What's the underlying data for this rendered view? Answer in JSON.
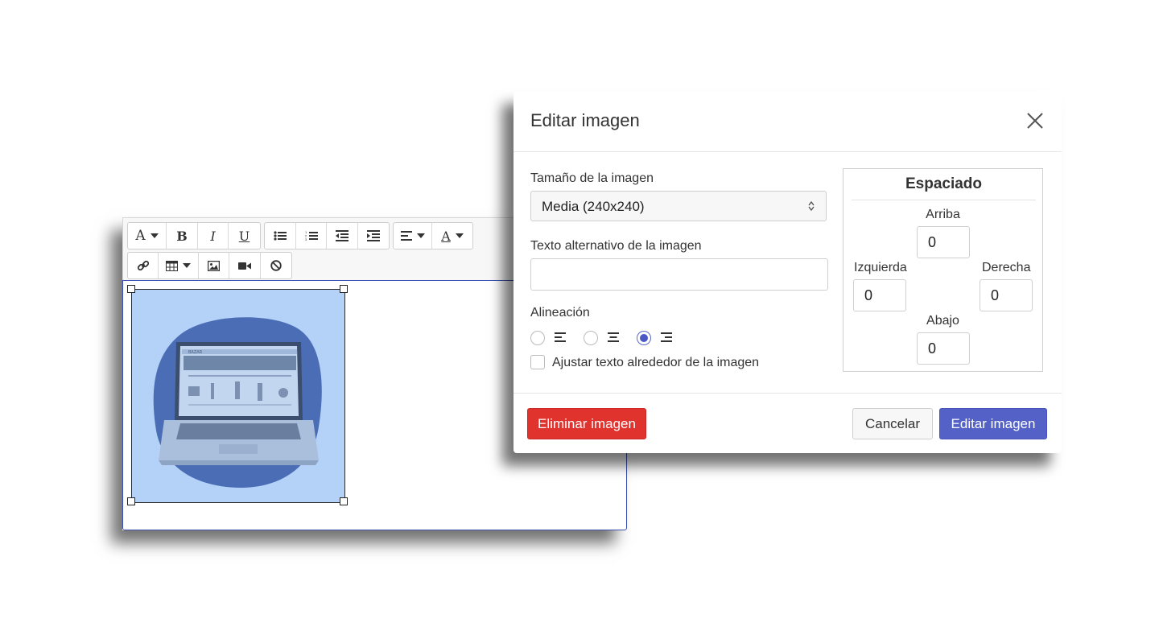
{
  "editor": {
    "toolbar": {
      "font_label": "A",
      "bold_label": "B",
      "italic_label": "I",
      "underline_label": "U",
      "color_label": "A"
    },
    "image": {
      "laptop_brand": "BAZAR"
    }
  },
  "modal": {
    "title": "Editar imagen",
    "size_label": "Tamaño de la imagen",
    "size_value": "Media (240x240)",
    "alt_label": "Texto alternativo de la imagen",
    "alt_value": "",
    "align_label": "Alineación",
    "align_options": [
      "left",
      "center",
      "right"
    ],
    "align_selected": "right",
    "wrap_label": "Ajustar texto alrededor de la imagen",
    "wrap_checked": false,
    "spacing": {
      "title": "Espaciado",
      "top_label": "Arriba",
      "top_value": "0",
      "left_label": "Izquierda",
      "left_value": "0",
      "right_label": "Derecha",
      "right_value": "0",
      "bottom_label": "Abajo",
      "bottom_value": "0"
    },
    "delete_button": "Eliminar imagen",
    "cancel_button": "Cancelar",
    "save_button": "Editar imagen"
  },
  "colors": {
    "accent": "#5462c8",
    "danger": "#e0332e",
    "image_bg": "#b4d2f7",
    "blob": "#4a6db5",
    "editor_border": "#3a4fb0"
  }
}
